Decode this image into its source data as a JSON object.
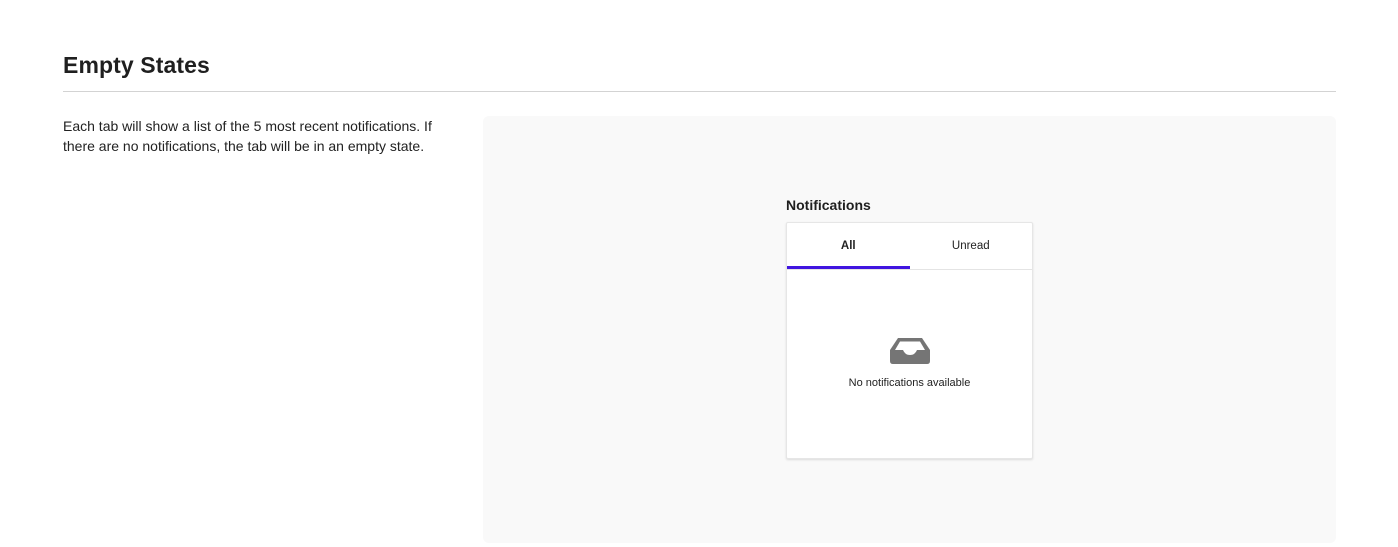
{
  "section": {
    "title": "Empty States",
    "description": "Each tab will show a list of the 5 most recent notifications. If there are no notifications, the tab will be in an empty state."
  },
  "widget": {
    "title": "Notifications",
    "tabs": [
      {
        "label": "All",
        "active": true
      },
      {
        "label": "Unread",
        "active": false
      }
    ],
    "empty_state": {
      "icon": "inbox-icon",
      "message": "No notifications available"
    }
  },
  "colors": {
    "accent": "#4015e0",
    "preview_background": "#f9f9f9",
    "icon": "#757575"
  }
}
